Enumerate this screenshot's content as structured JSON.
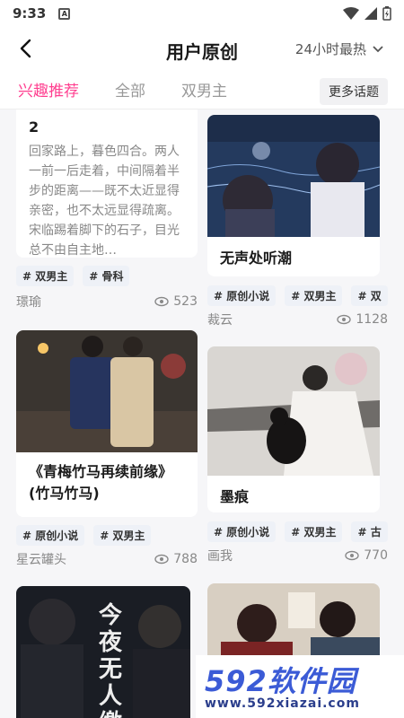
{
  "status": {
    "time": "9:33",
    "notif_icon": "A"
  },
  "header": {
    "title": "用户原创",
    "sort_label": "24小时最热"
  },
  "tabs": [
    {
      "label": "兴趣推荐"
    },
    {
      "label": "全部"
    },
    {
      "label": "双男主"
    }
  ],
  "more_topics": "更多话题",
  "cards": [
    {
      "title": "2",
      "excerpt": "回家路上，暮色四合。两人一前一后走着，中间隔着半步的距离——既不太近显得亲密，也不太远显得疏离。宋临踢着脚下的石子，目光总不由自主地…",
      "tags": [
        "# 双男主",
        "# 骨科"
      ],
      "author": "璟瑜",
      "views": "523"
    },
    {
      "title": "无声处听潮",
      "tags": [
        "# 原创小说",
        "# 双男主",
        "# 双"
      ],
      "author": "裁云",
      "views": "1128"
    },
    {
      "title": "《青梅竹马再续前缘》(竹马竹马)",
      "tags": [
        "# 原创小说",
        "# 双男主"
      ],
      "author": "星云罐头",
      "views": "788"
    },
    {
      "title": "墨痕",
      "tags": [
        "# 原创小说",
        "# 双男主",
        "# 古"
      ],
      "author": "画我",
      "views": "770"
    },
    {
      "title": "今夜无人缴",
      "tags": [],
      "author": "",
      "views": ""
    }
  ],
  "watermark": {
    "big": "592软件园",
    "small": "www.592xiazai.com"
  },
  "colors": {
    "accent": "#ff3e8f",
    "tag_bg": "#eef1f7",
    "page_bg": "#f6f6f8"
  }
}
